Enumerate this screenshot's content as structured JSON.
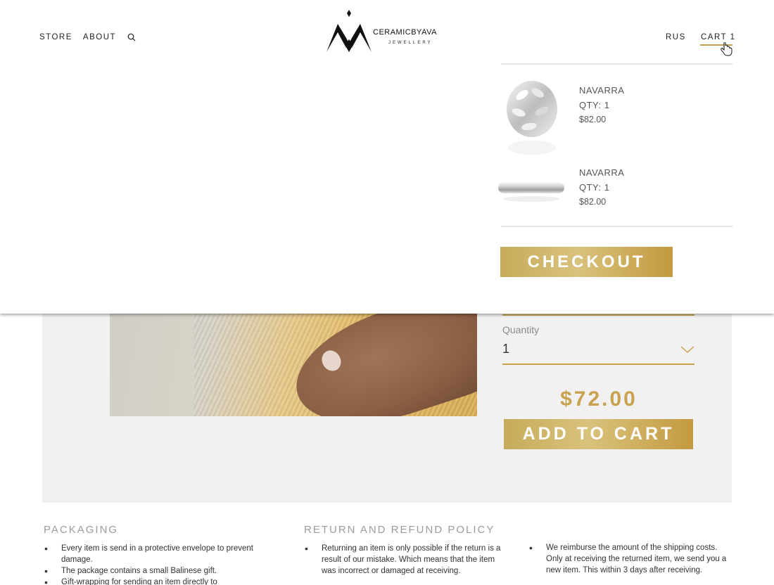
{
  "header": {
    "nav": [
      "STORE",
      "ABOUT"
    ],
    "logo": {
      "main": "CERAMICBYAVA",
      "sub": "JEWELLERY"
    },
    "language": "RUS",
    "cart_label": "CART 1",
    "accent_color": "#c9a24f"
  },
  "cart_dropdown": {
    "items": [
      {
        "name": "NAVARRA",
        "qty": "QTY: 1",
        "price": "$82.00",
        "image": "leaf-ring"
      },
      {
        "name": "NAVARRA",
        "qty": "QTY: 1",
        "price": "$82.00",
        "image": "band-ring"
      }
    ],
    "checkout_label": "CHECKOUT"
  },
  "product": {
    "quantity_label": "Quantity",
    "quantity_value": "1",
    "price": "$72.00",
    "add_to_cart_label": "ADD TO CART"
  },
  "info": {
    "packaging": {
      "heading": "PACKAGING",
      "items": [
        "Every item is send in a protective envelope to prevent damage.",
        "The package contains a small Balinese gift.",
        "Gift-wrapping for sending an item directly to"
      ]
    },
    "returns": {
      "heading": "RETURN AND REFUND POLICY",
      "items": [
        "Returning an item is only possible if the return is a result of our mistake. Which means that the item was incorrect or damaged at receiving."
      ]
    },
    "refund": {
      "items": [
        "We reimburse the amount of the shipping costs. Only at receiving the returned item, we send you a new item. This within 3 days after receiving."
      ]
    }
  }
}
